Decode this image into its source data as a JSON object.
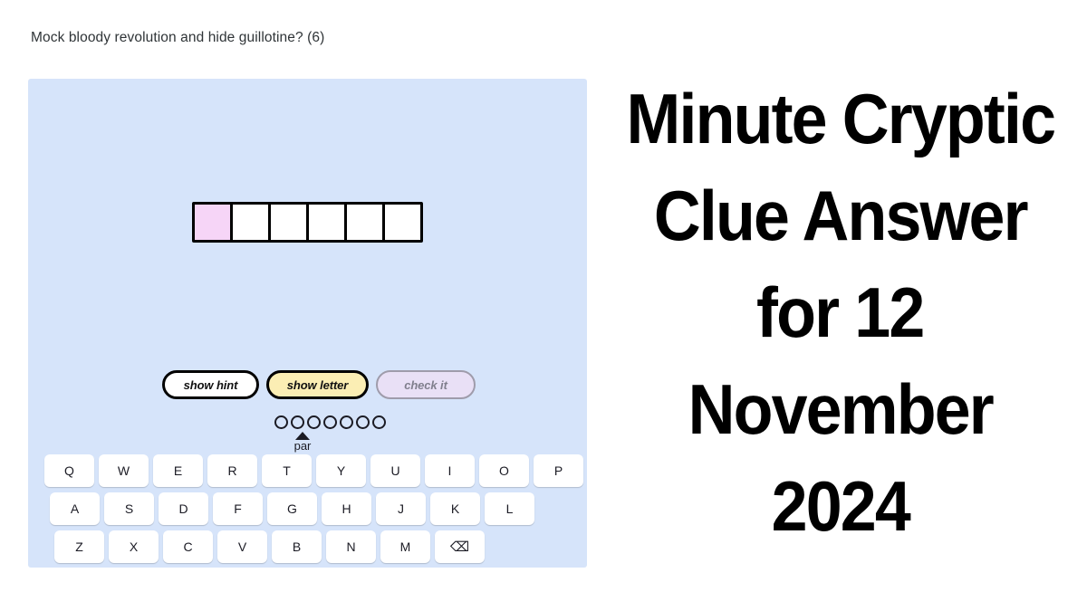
{
  "clue": {
    "text": "Mock bloody revolution and hide guillotine? (6)"
  },
  "puzzle": {
    "background_color": "#d6e4fa",
    "grid": {
      "length": 6,
      "cells": [
        {
          "letter": "",
          "state": "active"
        },
        {
          "letter": "",
          "state": "empty"
        },
        {
          "letter": "",
          "state": "empty"
        },
        {
          "letter": "",
          "state": "empty"
        },
        {
          "letter": "",
          "state": "empty"
        },
        {
          "letter": "",
          "state": "empty"
        }
      ],
      "active_cell_color": "#f6d5f7",
      "cell_color": "#ffffff",
      "border_color": "#000000"
    },
    "buttons": [
      {
        "label": "show hint",
        "style": "hint",
        "fill": "#ffffff",
        "border": "#000000",
        "enabled": true
      },
      {
        "label": "show letter",
        "style": "letter",
        "fill": "#fbeeb4",
        "border": "#000000",
        "enabled": true
      },
      {
        "label": "check it",
        "style": "check",
        "fill": "#e9e0f6",
        "border": "#9f9cab",
        "enabled": false
      }
    ],
    "par_meter": {
      "dot_count": 7,
      "marker_index": 1,
      "label": "par"
    },
    "keyboard": {
      "row1": [
        "Q",
        "W",
        "E",
        "R",
        "T",
        "Y",
        "U",
        "I",
        "O",
        "P"
      ],
      "row2": [
        "A",
        "S",
        "D",
        "F",
        "G",
        "H",
        "J",
        "K",
        "L"
      ],
      "row3": [
        "Z",
        "X",
        "C",
        "V",
        "B",
        "N",
        "M"
      ],
      "backspace_glyph": "⌫"
    }
  },
  "title": {
    "lines": [
      "Minute Cryptic",
      "Clue Answer",
      "for 12",
      "November",
      "2024"
    ]
  }
}
